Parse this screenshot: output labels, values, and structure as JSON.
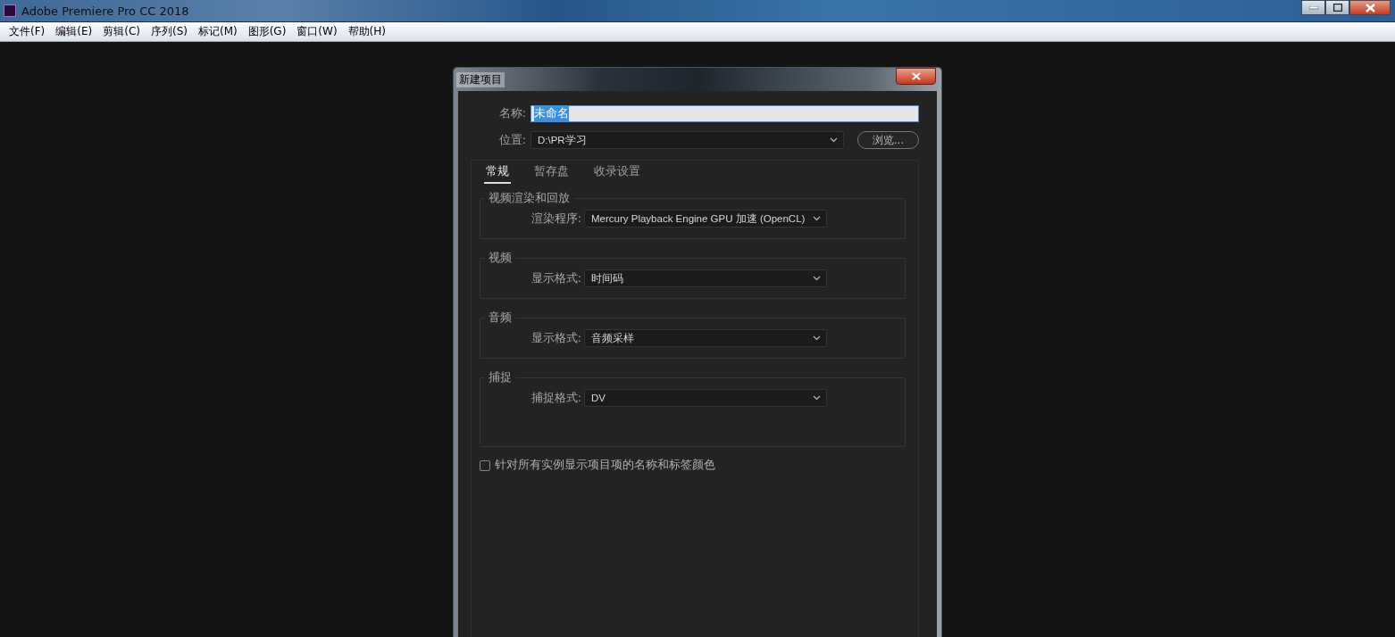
{
  "window": {
    "title": "Adobe Premiere Pro CC 2018"
  },
  "menu": [
    "文件(F)",
    "编辑(E)",
    "剪辑(C)",
    "序列(S)",
    "标记(M)",
    "图形(G)",
    "窗口(W)",
    "帮助(H)"
  ],
  "dialog": {
    "title": "新建项目",
    "name_label": "名称:",
    "name_value": "未命名",
    "location_label": "位置:",
    "location_value": "D:\\PR学习",
    "browse": "浏览...",
    "tabs": [
      {
        "label": "常规",
        "selected": true
      },
      {
        "label": "暂存盘",
        "selected": false
      },
      {
        "label": "收录设置",
        "selected": false
      }
    ],
    "groups": [
      {
        "title": "视频渲染和回放",
        "label": "渲染程序:",
        "value": "Mercury Playback Engine GPU 加速 (OpenCL)"
      },
      {
        "title": "视频",
        "label": "显示格式:",
        "value": "时间码"
      },
      {
        "title": "音频",
        "label": "显示格式:",
        "value": "音频采样"
      },
      {
        "title": "捕捉",
        "label": "捕捉格式:",
        "value": "DV"
      }
    ],
    "checkbox": {
      "label": "针对所有实例显示项目项的名称和标签颜色",
      "checked": false
    }
  }
}
